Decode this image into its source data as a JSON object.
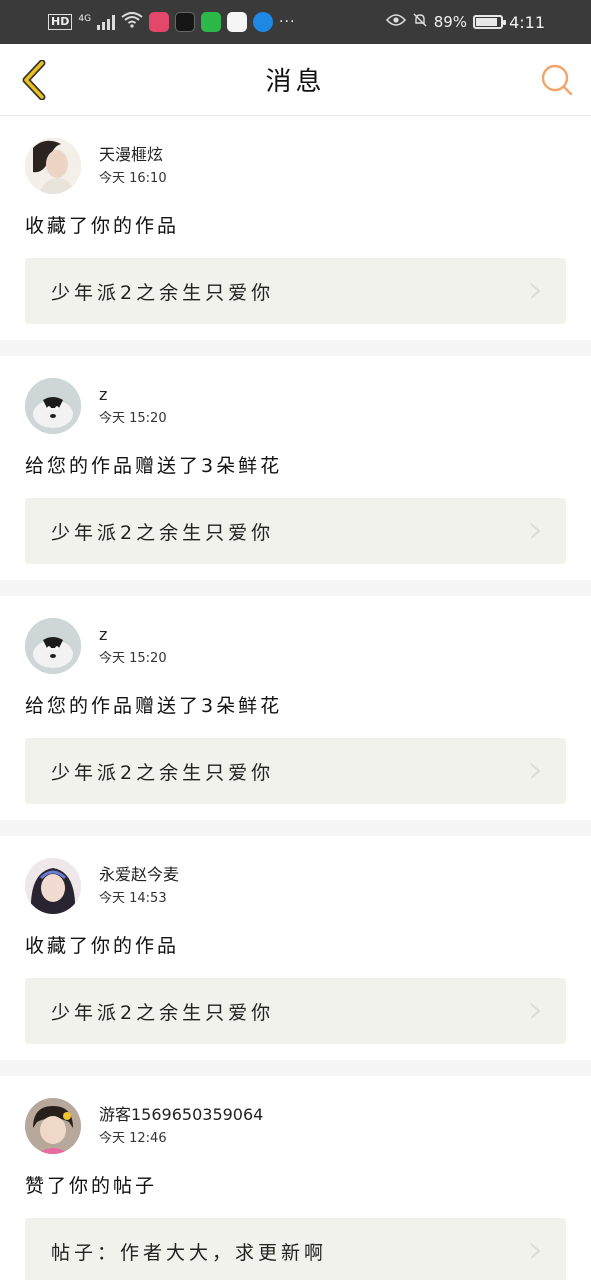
{
  "status_bar": {
    "network_hd": "HD",
    "network_type": "4G",
    "more": "···",
    "battery": "89%",
    "battery_fraction": 0.89,
    "time": "4:11",
    "app_colors": [
      "#e4476a",
      "#161616",
      "#2db84a",
      "#1a1a1a",
      "#1e88e5"
    ]
  },
  "header": {
    "title": "消息",
    "back_icon": "chevron-left-icon",
    "search_icon": "search-icon",
    "accent_color": "#e9c11a",
    "search_color": "#f0a66a"
  },
  "messages": [
    {
      "username": "天漫榧炫",
      "time": "今天 16:10",
      "action": "收藏了你的作品",
      "work": "少年派2之余生只爱你",
      "avatar": "avatar-woman-icon"
    },
    {
      "username": "z",
      "time": "今天 15:20",
      "action": "给您的作品赠送了3朵鲜花",
      "work": "少年派2之余生只爱你",
      "avatar": "avatar-dog-icon"
    },
    {
      "username": "z",
      "time": "今天 15:20",
      "action": "给您的作品赠送了3朵鲜花",
      "work": "少年派2之余生只爱你",
      "avatar": "avatar-dog-icon"
    },
    {
      "username": "永爱赵今麦",
      "time": "今天 14:53",
      "action": "收藏了你的作品",
      "work": "少年派2之余生只爱你",
      "avatar": "avatar-girl-icon"
    },
    {
      "username": "游客1569650359064",
      "time": "今天 12:46",
      "action": "赞了你的帖子",
      "work": "帖子：作者大大，求更新啊",
      "avatar": "avatar-child-icon"
    }
  ]
}
